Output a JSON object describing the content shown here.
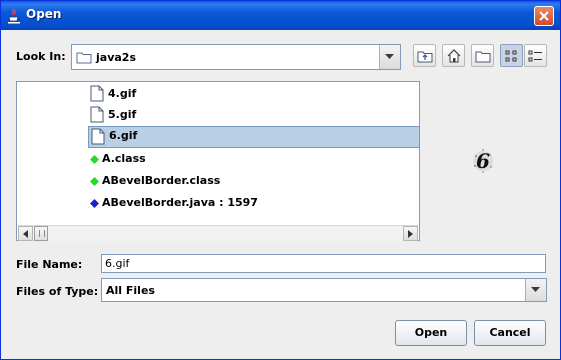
{
  "window": {
    "title": "Open",
    "colors": {
      "titlebar": "#0a58d8",
      "selection": "#b8cfe5",
      "close": "#d1492a"
    }
  },
  "look_in": {
    "label": "Look In:",
    "value": "java2s"
  },
  "toolbar": {
    "icons": [
      "up-one-level-icon",
      "home-icon",
      "new-folder-icon",
      "list-view-icon",
      "details-view-icon"
    ]
  },
  "files": [
    {
      "name": "4.gif",
      "icon": "file-icon",
      "selected": false
    },
    {
      "name": "5.gif",
      "icon": "file-icon",
      "selected": false
    },
    {
      "name": "6.gif",
      "icon": "file-icon",
      "selected": true
    },
    {
      "name": "A.class",
      "icon": "green-diamond-icon",
      "selected": false
    },
    {
      "name": "ABevelBorder.class",
      "icon": "green-diamond-icon",
      "selected": false
    },
    {
      "name": "ABevelBorder.java : 1597",
      "icon": "blue-diamond-icon",
      "selected": false
    }
  ],
  "preview": {
    "text": "6"
  },
  "file_name": {
    "label": "File Name:",
    "value": "6.gif"
  },
  "file_type": {
    "label": "Files of Type:",
    "value": "All Files"
  },
  "buttons": {
    "open": "Open",
    "cancel": "Cancel"
  }
}
